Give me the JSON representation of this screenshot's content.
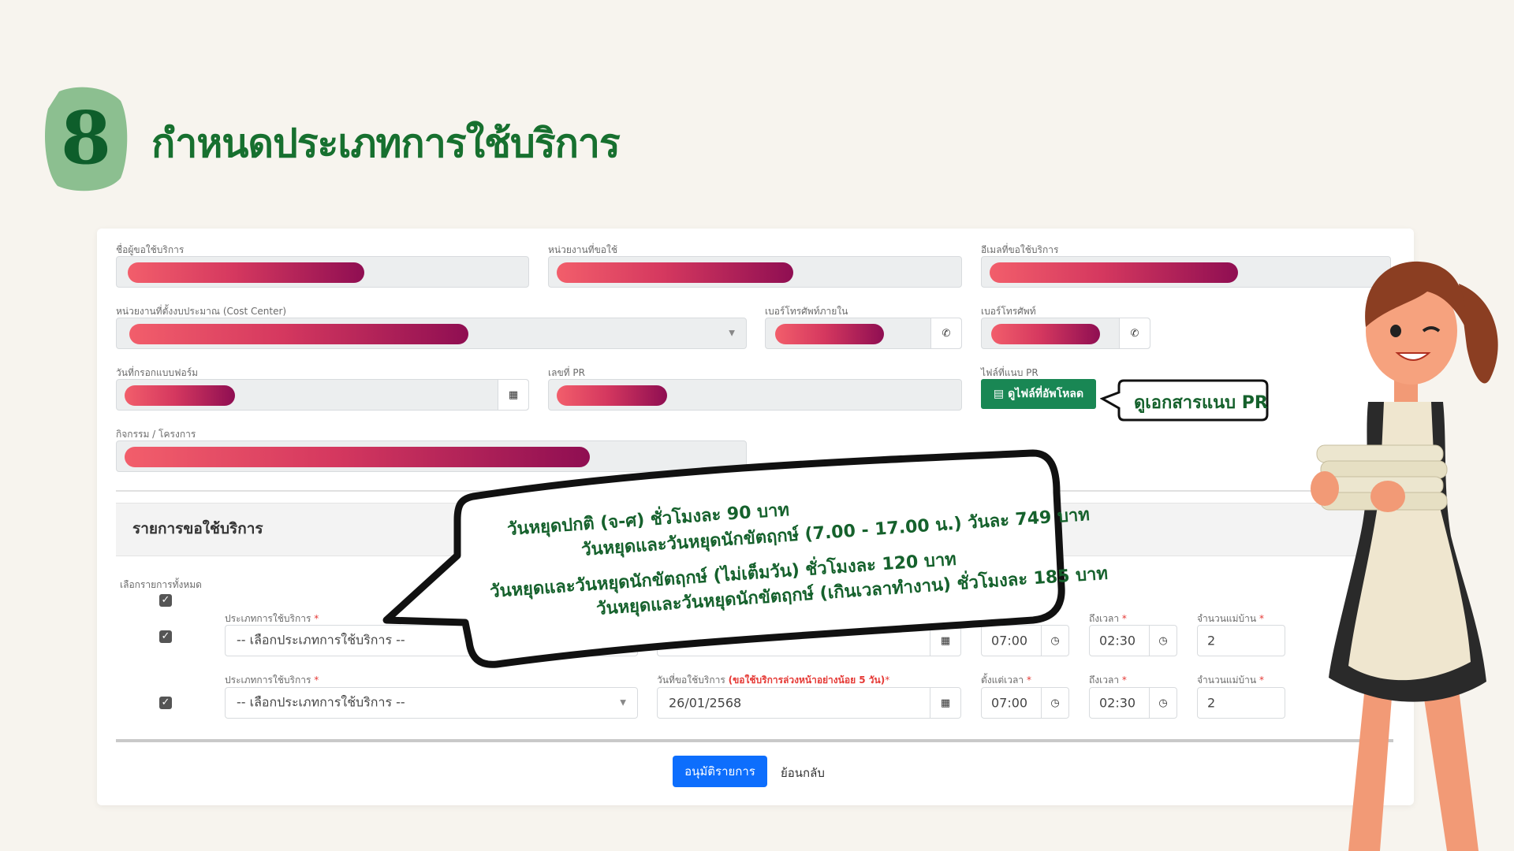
{
  "header": {
    "step_number": "8",
    "title": "กำหนดประเภทการใช้บริการ"
  },
  "form": {
    "requester_label": "ชื่อผู้ขอใช้บริการ",
    "department_label": "หน่วยงานที่ขอใช้",
    "email_label": "อีเมลที่ขอใช้บริการ",
    "cost_center_label": "หน่วยงานที่ตั้งงบประมาณ (Cost Center)",
    "internal_phone_label": "เบอร์โทรศัพท์ภายใน",
    "phone_label": "เบอร์โทรศัพท์",
    "form_date_label": "วันที่กรอกแบบฟอร์ม",
    "pr_number_label": "เลขที่ PR",
    "pr_file_label": "ไฟล์ที่แนบ PR",
    "pr_file_button": "ดูไฟล์ที่อัพโหลด",
    "activity_label": "กิจกรรม / โครงการ"
  },
  "services": {
    "section_title": "รายการขอใช้บริการ",
    "select_all_label": "เลือกรายการทั้งหมด",
    "service_type_label": "ประเภทการใช้บริการ",
    "service_date_label": "วันที่ขอใช้บริการ",
    "service_date_note": "(ขอใช้บริการล่วงหน้าอย่างน้อย 5 วัน)",
    "start_time_label": "ตั้งแต่เวลา",
    "end_time_label": "ถึงเวลา",
    "maid_count_label": "จำนวนแม่บ้าน",
    "required_mark": "*",
    "rows": [
      {
        "service_type": "-- เลือกประเภทการใช้บริการ --",
        "date": "",
        "start": "07:00",
        "end": "02:30",
        "count": "2"
      },
      {
        "service_type": "-- เลือกประเภทการใช้บริการ --",
        "date": "26/01/2568",
        "start": "07:00",
        "end": "02:30",
        "count": "2"
      }
    ]
  },
  "actions": {
    "approve_button": "อนุมัติรายการ",
    "back_link": "ย้อนกลับ"
  },
  "callouts": {
    "pr_callout": "ดูเอกสารแนบ PR",
    "rates": [
      "วันหยุดปกติ (จ-ศ) ชั่วโมงละ 90 บาท",
      "วันหยุดและวันหยุดนักขัตฤกษ์ (7.00 - 17.00 น.) วันละ 749 บาท",
      "วันหยุดและวันหยุดนักขัตฤกษ์ (ไม่เต็มวัน) ชั่วโมงละ 120 บาท",
      "วันหยุดและวันหยุดนักขัตฤกษ์ (เกินเวลาทำงาน) ชั่วโมงละ 185 บาท"
    ]
  },
  "icons": {
    "phone": "phone-icon",
    "calendar": "calendar-icon",
    "clock": "clock-icon",
    "file": "file-icon",
    "caret": "chevron-down-icon"
  },
  "colors": {
    "accent_green": "#198754",
    "primary_blue": "#0d6efd",
    "title_green": "#17702f",
    "badge_green": "#8cbf90"
  }
}
